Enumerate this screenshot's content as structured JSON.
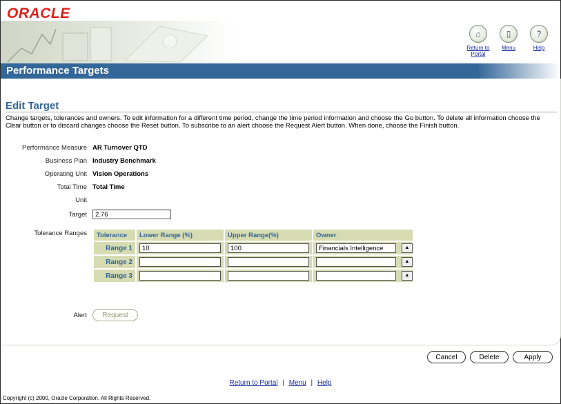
{
  "logo": "ORACLE",
  "header": {
    "return_label_1": "Return to",
    "return_label_2": "Portal",
    "menu_label": "Menu",
    "help_label": "Help"
  },
  "page_title": "Performance Targets",
  "section_title": "Edit Target",
  "instructions": "Change targets, tolerances and owners. To edit information for a different time period, change the time period information and choose the Go button. To delete all information choose the Clear button or to discard changes choose the Reset button. To subscribe to an alert choose the Request Alert button. When done, choose the Finish button.",
  "fields": {
    "performance_measure_label": "Performance Measure",
    "performance_measure_value": "AR Turnover QTD",
    "business_plan_label": "Business Plan",
    "business_plan_value": "Industry Benchmark",
    "operating_unit_label": "Operating Unit",
    "operating_unit_value": "Vision Operations",
    "total_time_label": "Total Time",
    "total_time_value": "Total Time",
    "unit_label": "Unit",
    "target_label": "Target",
    "target_value": "2.76",
    "tolerance_ranges_label": "Tolerance Ranges",
    "alert_label": "Alert"
  },
  "tolerance_table": {
    "headers": [
      "Tolerance",
      "Lower Range (%)",
      "Upper Range(%)",
      "Owner"
    ],
    "rows": [
      {
        "label": "Range 1",
        "lower": "10",
        "upper": "100",
        "owner": "Financials Intelligence"
      },
      {
        "label": "Range 2",
        "lower": "",
        "upper": "",
        "owner": ""
      },
      {
        "label": "Range 3",
        "lower": "",
        "upper": "",
        "owner": ""
      }
    ]
  },
  "buttons": {
    "request": "Request",
    "cancel": "Cancel",
    "delete": "Delete",
    "apply": "Apply"
  },
  "footer_links": {
    "return": "Return to Portal",
    "menu": "Menu",
    "help": "Help",
    "separator": "|"
  },
  "copyright": "Copyright (c) 2000, Oracle Corporation. All Rights Reserved.",
  "colors": {
    "title_bar": "#336699",
    "table_bg": "#d6dbb2",
    "oracle_red": "#e0201b"
  }
}
